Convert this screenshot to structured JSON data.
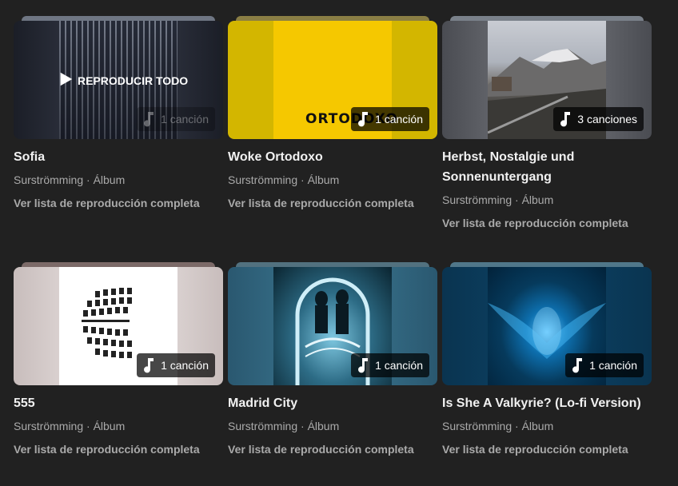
{
  "play_all_label": "REPRODUCIR TODO",
  "playlist_link_label": "Ver lista de reproducción completa",
  "albums": [
    {
      "title": "Sofia",
      "meta": "Surströmming · Álbum",
      "count": "1 canción"
    },
    {
      "title": "Woke Ortodoxo",
      "meta": "Surströmming · Álbum",
      "count": "1 canción",
      "art_text": "ORTODOXO"
    },
    {
      "title": "Herbst, Nostalgie und Sonnenuntergang",
      "meta": "Surströmming · Álbum",
      "count": "3 canciones"
    },
    {
      "title": "555",
      "meta": "Surströmming · Álbum",
      "count": "1 canción"
    },
    {
      "title": "Madrid City",
      "meta": "Surströmming · Álbum",
      "count": "1 canción"
    },
    {
      "title": "Is She A Valkyrie? (Lo-fi Version)",
      "meta": "Surströmming · Álbum",
      "count": "1 canción"
    }
  ],
  "icons": {
    "count_icon": "music-note-icon",
    "play_icon": "play-icon"
  },
  "colors": {
    "background": "#212121",
    "text_primary": "#f1f1f1",
    "text_secondary": "#aaaaaa"
  }
}
